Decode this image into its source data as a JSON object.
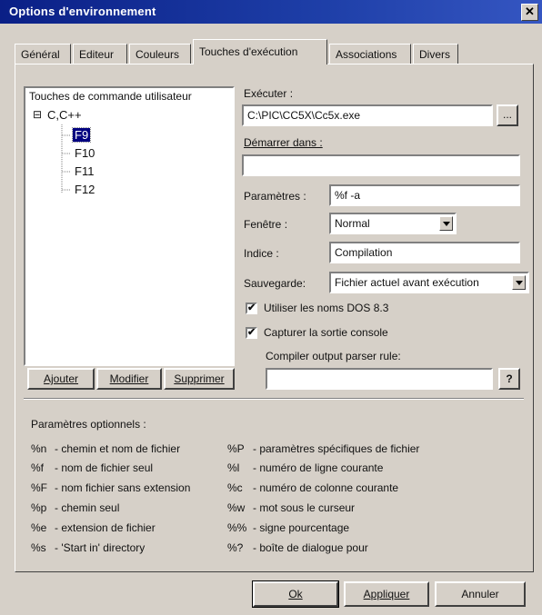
{
  "window": {
    "title": "Options d'environnement",
    "close_glyph": "✕"
  },
  "tabs": [
    {
      "label": "Général"
    },
    {
      "label": "Editeur"
    },
    {
      "label": "Couleurs"
    },
    {
      "label": "Touches d'exécution"
    },
    {
      "label": "Associations"
    },
    {
      "label": "Divers"
    }
  ],
  "tree": {
    "header": "Touches de commande utilisateur",
    "root": "C,C++",
    "expander": "⊟",
    "items": [
      "F9",
      "F10",
      "F11",
      "F12"
    ],
    "selected": "F9"
  },
  "tree_buttons": {
    "add": "Ajouter",
    "modify": "Modifier",
    "delete": "Supprimer"
  },
  "fields": {
    "executer_label": "Exécuter :",
    "executer_value": "C:\\PIC\\CC5X\\Cc5x.exe",
    "browse_label": "...",
    "demarrer_label": "Démarrer dans :",
    "demarrer_value": "",
    "parametres_label": "Paramètres :",
    "parametres_value": "%f -a",
    "fenetre_label": "Fenêtre :",
    "fenetre_value": "Normal",
    "indice_label": "Indice :",
    "indice_value": "Compilation",
    "sauvegarde_label": "Sauvegarde:",
    "sauvegarde_value": "Fichier actuel avant exécution"
  },
  "checkboxes": {
    "dos83_label": "Utiliser les noms DOS 8.3",
    "dos83_checked": "✔",
    "capture_label": "Capturer la sortie console",
    "capture_checked": "✔"
  },
  "parser": {
    "label": "Compiler output parser rule:",
    "value": "",
    "help_label": "?"
  },
  "optional_params": {
    "title": "Paramètres optionnels :",
    "left": [
      {
        "code": "%n",
        "desc": "- chemin et nom de fichier"
      },
      {
        "code": "%f",
        "desc": "- nom de fichier seul"
      },
      {
        "code": "%F",
        "desc": "- nom fichier sans extension"
      },
      {
        "code": "%p",
        "desc": "- chemin seul"
      },
      {
        "code": "%e",
        "desc": "- extension de fichier"
      },
      {
        "code": "%s",
        "desc": "- 'Start in' directory"
      }
    ],
    "right": [
      {
        "code": "%P",
        "desc": "- paramètres spécifiques de fichier"
      },
      {
        "code": "%l",
        "desc": "- numéro de ligne courante"
      },
      {
        "code": "%c",
        "desc": "- numéro de colonne courante"
      },
      {
        "code": "%w",
        "desc": "- mot sous le curseur"
      },
      {
        "code": "%%",
        "desc": "- signe pourcentage"
      },
      {
        "code": "%?",
        "desc": "- boîte de dialogue pour"
      }
    ]
  },
  "dialog_buttons": {
    "ok": "Ok",
    "apply": "Appliquer",
    "cancel": "Annuler"
  }
}
